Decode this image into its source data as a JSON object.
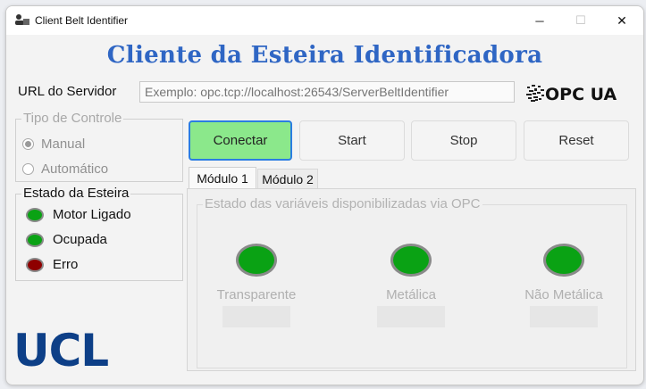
{
  "window": {
    "title": "Client Belt Identifier"
  },
  "titlebar_buttons": {
    "minimize": "─",
    "maximize": "☐",
    "close": "✕"
  },
  "heading": "Cliente da Esteira Identificadora",
  "url": {
    "label": "URL do Servidor",
    "placeholder": "Exemplo: opc.tcp://localhost:26543/ServerBeltIdentifier"
  },
  "opc_logo": {
    "text": "OPC UA"
  },
  "control_type": {
    "legend": "Tipo de Controle",
    "options": [
      {
        "label": "Manual",
        "selected": true
      },
      {
        "label": "Automático",
        "selected": false
      }
    ]
  },
  "belt_state": {
    "legend": "Estado da Esteira",
    "items": [
      {
        "label": "Motor Ligado",
        "color": "#0aa214"
      },
      {
        "label": "Ocupada",
        "color": "#0aa214"
      },
      {
        "label": "Erro",
        "color": "#8e0000"
      }
    ]
  },
  "buttons": {
    "connect": "Conectar",
    "start": "Start",
    "stop": "Stop",
    "reset": "Reset"
  },
  "tabs": [
    {
      "label": "Módulo 1",
      "active": true
    },
    {
      "label": "Módulo 2",
      "active": false
    }
  ],
  "opc_panel": {
    "legend": "Estado das variáveis disponibilizadas via OPC",
    "variables": [
      {
        "label": "Transparente",
        "value": ""
      },
      {
        "label": "Metálica",
        "value": ""
      },
      {
        "label": "Não Metálica",
        "value": ""
      }
    ]
  },
  "logo": {
    "text": "UCL"
  },
  "colors": {
    "accent_blue": "#2f66c4",
    "connect_green": "#8be88b",
    "lamp_green": "#0aa214",
    "lamp_red": "#8e0000",
    "ucl_blue": "#0d3f87"
  }
}
